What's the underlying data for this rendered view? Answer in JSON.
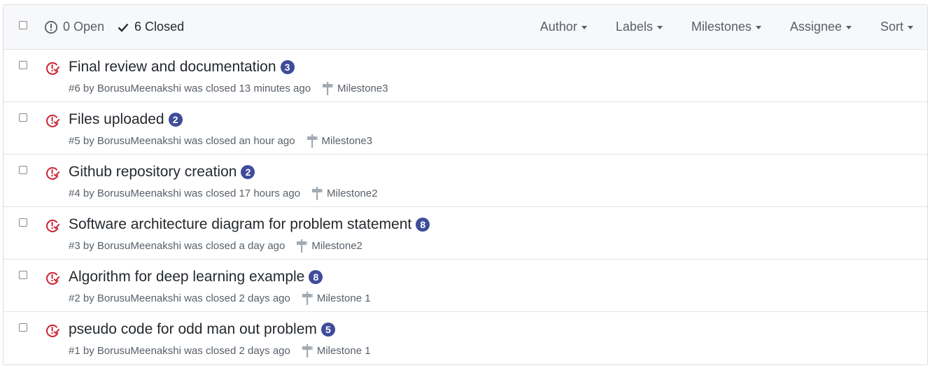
{
  "header": {
    "open_label": "0 Open",
    "closed_label": "6 Closed",
    "filters": [
      "Author",
      "Labels",
      "Milestones",
      "Assignee",
      "Sort"
    ]
  },
  "issues": [
    {
      "title": "Final review and documentation",
      "comments": "3",
      "meta": "#6 by BorusuMeenakshi was closed 13 minutes ago",
      "milestone": "Milestone3"
    },
    {
      "title": "Files uploaded",
      "comments": "2",
      "meta": "#5 by BorusuMeenakshi was closed an hour ago",
      "milestone": "Milestone3"
    },
    {
      "title": "Github repository creation",
      "comments": "2",
      "meta": "#4 by BorusuMeenakshi was closed 17 hours ago",
      "milestone": "Milestone2"
    },
    {
      "title": "Software architecture diagram for problem statement",
      "comments": "8",
      "meta": "#3 by BorusuMeenakshi was closed a day ago",
      "milestone": "Milestone2"
    },
    {
      "title": "Algorithm for deep learning example",
      "comments": "8",
      "meta": "#2 by BorusuMeenakshi was closed 2 days ago",
      "milestone": "Milestone 1"
    },
    {
      "title": "pseudo code for odd man out problem",
      "comments": "5",
      "meta": "#1 by BorusuMeenakshi was closed 2 days ago",
      "milestone": "Milestone 1"
    }
  ],
  "colors": {
    "closed_icon": "#cb2431",
    "count_badge": "#3f4c9a"
  }
}
